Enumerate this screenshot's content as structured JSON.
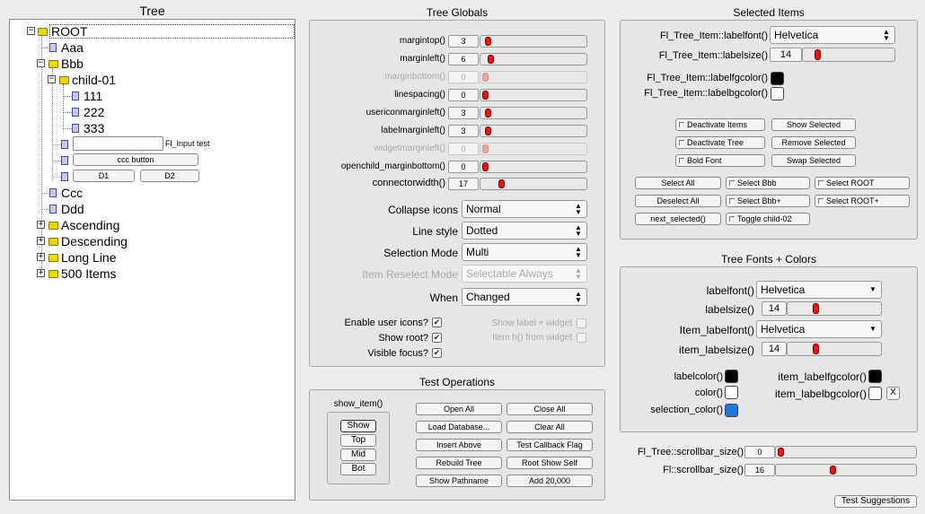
{
  "tree": {
    "title": "Tree",
    "items": {
      "root": "ROOT",
      "aaa": "Aaa",
      "bbb": "Bbb",
      "child01": "child-01",
      "n111": "111",
      "n222": "222",
      "n333": "333",
      "input_label": "Fl_Input test",
      "ccc_button": "ccc button",
      "d1": "D1",
      "d2": "D2",
      "ccc": "Ccc",
      "ddd": "Ddd",
      "ascending": "Ascending",
      "descending": "Descending",
      "long_line": "Long Line",
      "items500": "500 Items"
    }
  },
  "globals": {
    "title": "Tree Globals",
    "marginTop": {
      "label": "margintop()",
      "value": "3",
      "level": 0.03
    },
    "marginLeft": {
      "label": "marginleft()",
      "value": "6",
      "level": 0.06
    },
    "marginBottom": {
      "label": "marginbottom()",
      "value": "0",
      "level": 0.0
    },
    "lineSpacing": {
      "label": "linespacing()",
      "value": "0",
      "level": 0.0
    },
    "userIconMarginLeft": {
      "label": "usericonmarginleft()",
      "value": "3",
      "level": 0.03
    },
    "labelMarginLeft": {
      "label": "labelmarginleft()",
      "value": "3",
      "level": 0.03
    },
    "widgetMarginLeft": {
      "label": "widgetmarginleft()",
      "value": "0",
      "level": 0.0
    },
    "openChildMarginBottom": {
      "label": "openchild_marginbottom()",
      "value": "0",
      "level": 0.0
    },
    "connectorWidth": {
      "label": "connectorwidth()",
      "value": "17",
      "level": 0.17
    },
    "collapseIcons": {
      "label": "Collapse icons",
      "value": "Normal"
    },
    "lineStyle": {
      "label": "Line style",
      "value": "Dotted"
    },
    "selectionMode": {
      "label": "Selection Mode",
      "value": "Multi"
    },
    "itemReselectMode": {
      "label": "Item Reselect Mode",
      "value": "Selectable Always"
    },
    "when": {
      "label": "When",
      "value": "Changed"
    },
    "enableUserIcons": "Enable user icons?",
    "showRoot": "Show root?",
    "visibleFocus": "Visible focus?",
    "showLabelWidget": "Show label + widget",
    "itemHFromWidget": "Item h() from widget"
  },
  "testops": {
    "title": "Test Operations",
    "showItem": {
      "title": "show_item()",
      "show": "Show",
      "top": "Top",
      "mid": "Mid",
      "bot": "Bot"
    },
    "openAll": "Open All",
    "closeAll": "Close All",
    "loadDatabase": "Load Database...",
    "clearAll": "Clear All",
    "insertAbove": "Insert Above",
    "testCallbackFlag": "Test Callback Flag",
    "rebuildTree": "Rebuild Tree",
    "rootShowSelf": "Root Show Self",
    "showPathname": "Show Pathname",
    "add20000": "Add 20,000"
  },
  "selected": {
    "title": "Selected Items",
    "labelFont": {
      "label": "Fl_Tree_Item::labelfont()",
      "value": "Helvetica"
    },
    "labelSize": {
      "label": "Fl_Tree_Item::labelsize()",
      "value": "14",
      "level": 0.12
    },
    "labelFgColor": {
      "label": "Fl_Tree_Item::labelfgcolor()",
      "color": "#000000"
    },
    "labelBgColor": {
      "label": "Fl_Tree_Item::labelbgcolor()",
      "color": "#ffffff"
    },
    "deactivateItems": "Deactivate Items",
    "showSelected": "Show Selected",
    "deactivateTree": "Deactivate Tree",
    "removeSelected": "Remove Selected",
    "boldFont": "Bold Font",
    "swapSelected": "Swap Selected",
    "selectAll": "Select All",
    "selectBbb": "Select Bbb",
    "selectRoot": "Select ROOT",
    "deselectAll": "Deselect All",
    "selectBbbPlus": "Select Bbb+",
    "selectRootPlus": "Select ROOT+",
    "nextSelected": "next_selected()",
    "toggleChild02": "Toggle child-02"
  },
  "fonts": {
    "title": "Tree Fonts + Colors",
    "labelFont": {
      "label": "labelfont()",
      "value": "Helvetica"
    },
    "labelSize": {
      "label": "labelsize()",
      "value": "14",
      "level": 0.28
    },
    "itemLabelFont": {
      "label": "Item_labelfont()",
      "value": "Helvetica"
    },
    "itemLabelSize": {
      "label": "item_labelsize()",
      "value": "14",
      "level": 0.28
    },
    "labelColor": {
      "label": "labelcolor()",
      "color": "#000000"
    },
    "color": {
      "label": "color()",
      "color": "#ffffff"
    },
    "selectionColor": {
      "label": "selection_color()",
      "color": "#1e78d6"
    },
    "itemLabelFgColor": {
      "label": "item_labelfgcolor()",
      "color": "#000000"
    },
    "itemLabelBgColor": {
      "label": "item_labelbgcolor()",
      "color": "#ffffff"
    },
    "clearBg": "X"
  },
  "scrollbars": {
    "treeScrollbarSize": {
      "label": "Fl_Tree::scrollbar_size()",
      "value": "0",
      "level": 0.0
    },
    "flScrollbarSize": {
      "label": "Fl::scrollbar_size()",
      "value": "16",
      "level": 0.4
    }
  },
  "testSuggestions": "Test Suggestions"
}
